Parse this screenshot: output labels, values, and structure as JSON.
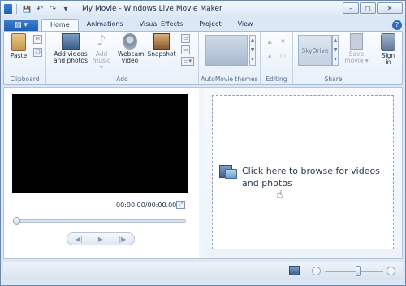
{
  "window": {
    "title": "My Movie - Windows Live Movie Maker",
    "controls": {
      "minimize": "–",
      "maximize": "▢",
      "close": "✕"
    }
  },
  "qat": {
    "save": "💾",
    "undo": "↶",
    "redo": "↷",
    "customize": "▾"
  },
  "app_menu": {
    "label": "▤ ▾"
  },
  "tabs": [
    {
      "label": "Home",
      "active": true
    },
    {
      "label": "Animations"
    },
    {
      "label": "Visual Effects"
    },
    {
      "label": "Project"
    },
    {
      "label": "View"
    }
  ],
  "ribbon": {
    "clipboard": {
      "label": "Clipboard",
      "paste": "Paste",
      "cut": "✂",
      "copy": "❐"
    },
    "add": {
      "label": "Add",
      "add_videos": "Add videos and photos",
      "add_music": "Add music ▾",
      "webcam": "Webcam video",
      "snapshot": "Snapshot",
      "small": [
        "▭",
        "▭",
        "▭▾"
      ]
    },
    "themes": {
      "label": "AutoMovie themes"
    },
    "editing": {
      "label": "Editing"
    },
    "share": {
      "label": "Share",
      "skydrive": "SkyDrive",
      "save_movie": "Save movie ▾",
      "sign_in": "Sign in"
    },
    "help": "?"
  },
  "preview": {
    "timecode": "00:00.00/00:00.00",
    "fullscreen": "⤢",
    "controls": {
      "prev": "◀|",
      "play": "▶",
      "next": "|▶"
    }
  },
  "storyboard": {
    "browse_text": "Click here to browse for videos and photos"
  },
  "statusbar": {
    "zoom_minus": "−",
    "zoom_plus": "+",
    "zoom_level": 0.6
  },
  "colors": {
    "accent": "#1f5fb4",
    "window_bg": "#dbe7f5",
    "preview_bg": "#000000"
  }
}
